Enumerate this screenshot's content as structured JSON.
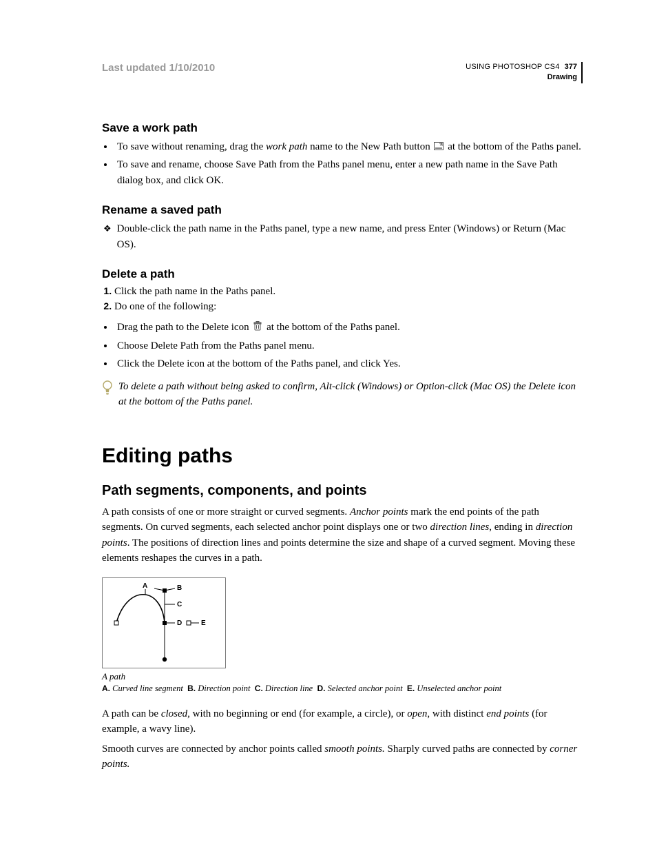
{
  "header": {
    "last_updated": "Last updated 1/10/2010",
    "product": "USING PHOTOSHOP CS4",
    "page_number": "377",
    "chapter": "Drawing"
  },
  "sec_save": {
    "title": "Save a work path",
    "b1_a": "To save without renaming, drag the ",
    "b1_i": "work path",
    "b1_b": " name to the New Path button ",
    "b1_c": " at the bottom of the Paths panel.",
    "b2": "To save and rename, choose Save Path from the Paths panel menu, enter a new path name in the Save Path dialog box, and click OK."
  },
  "sec_rename": {
    "title": "Rename a saved path",
    "line": "Double-click the path name in the Paths panel, type a new name, and press Enter (Windows) or Return (Mac OS)."
  },
  "sec_delete": {
    "title": "Delete a path",
    "s1": "Click the path name in the Paths panel.",
    "s2": "Do one of the following:",
    "b1_a": "Drag the path to the Delete icon ",
    "b1_b": " at the bottom of the Paths panel.",
    "b2": "Choose Delete Path from the Paths panel menu.",
    "b3": "Click the Delete icon at the bottom of the Paths panel, and click Yes.",
    "tip": "To delete a path without being asked to confirm, Alt-click (Windows) or Option-click (Mac OS) the Delete icon at the bottom of the Paths panel."
  },
  "editing": {
    "h1": "Editing paths",
    "h2": "Path segments, components, and points",
    "p1_a": "A path consists of one or more straight or curved segments. ",
    "p1_i1": "Anchor points",
    "p1_b": " mark the end points of the path segments. On curved segments, each selected anchor point displays one or two ",
    "p1_i2": "direction lines",
    "p1_c": ", ending in ",
    "p1_i3": "direction points",
    "p1_d": ". The positions of direction lines and points determine the size and shape of a curved segment. Moving these elements reshapes the curves in a path.",
    "diagram_labels": {
      "A": "A",
      "B": "B",
      "C": "C",
      "D": "D",
      "E": "E"
    },
    "caption": "A path",
    "legend": {
      "A_k": "A.",
      "A_v": "Curved line segment",
      "B_k": "B.",
      "B_v": "Direction point",
      "C_k": "C.",
      "C_v": "Direction line",
      "D_k": "D.",
      "D_v": "Selected anchor point",
      "E_k": "E.",
      "E_v": "Unselected anchor point"
    },
    "p2_a": "A path can be ",
    "p2_i1": "closed",
    "p2_b": ", with no beginning or end (for example, a circle), or ",
    "p2_i2": "open",
    "p2_c": ", with distinct ",
    "p2_i3": "end points",
    "p2_d": " (for example, a wavy line).",
    "p3_a": "Smooth curves are connected by anchor points called ",
    "p3_i1": "smooth points.",
    "p3_b": " Sharply curved paths are connected by ",
    "p3_i2": "corner points.",
    "p3_c": ""
  }
}
